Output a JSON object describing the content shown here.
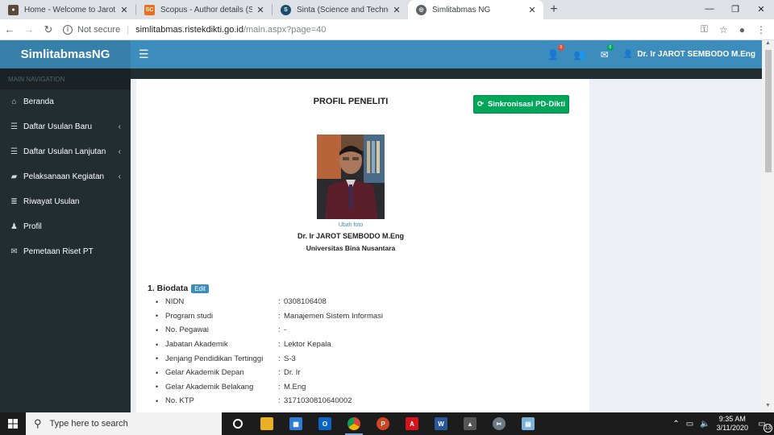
{
  "browser": {
    "tabs": [
      {
        "title": "Home - Welcome to Jarot Suroso",
        "favicon": "person-avatar-icon",
        "color": "#5a4a3a",
        "active": false
      },
      {
        "title": "Scopus - Author details (Suroso,",
        "favicon": "scopus-icon",
        "color": "#e9711c",
        "active": false
      },
      {
        "title": "Sinta (Science and Technology Ind",
        "favicon": "sinta-icon",
        "color": "#1a4d6e",
        "active": false
      },
      {
        "title": "Simlitabmas NG",
        "favicon": "globe-icon",
        "color": "#5f6368",
        "active": true
      }
    ],
    "new_tab": "+",
    "address": {
      "security": "Not secure",
      "host": "simlitabmas.ristekdikti.go.id",
      "path": "/main.aspx?page=40"
    }
  },
  "header": {
    "logo": "SimlitabmasNG",
    "badges": [
      {
        "icon": "user-plus-icon",
        "count": "0",
        "color": "#dd4b39"
      },
      {
        "icon": "users-icon",
        "count": "",
        "color": ""
      },
      {
        "icon": "envelope-icon",
        "count": "0",
        "color": "#00a65a"
      }
    ],
    "user_name": "Dr. Ir JAROT SEMBODO M.Eng"
  },
  "sidebar": {
    "header": "MAIN NAVIGATION",
    "items": [
      {
        "label": "Beranda",
        "icon": "home-icon",
        "chevron": false
      },
      {
        "label": "Daftar Usulan Baru",
        "icon": "list-icon",
        "chevron": true
      },
      {
        "label": "Daftar Usulan Lanjutan",
        "icon": "list-icon",
        "chevron": true
      },
      {
        "label": "Pelaksanaan Kegiatan",
        "icon": "book-icon",
        "chevron": true
      },
      {
        "label": "Riwayat Usulan",
        "icon": "database-icon",
        "chevron": false
      },
      {
        "label": "Profil",
        "icon": "user-icon",
        "chevron": false
      },
      {
        "label": "Pemetaan Riset PT",
        "icon": "envelope-icon",
        "chevron": false
      }
    ]
  },
  "profile": {
    "title": "PROFIL PENELITI",
    "sync_button": "Sinkronisasi PD-Dikti",
    "change_photo": "Ubah foto",
    "name": "Dr. Ir JAROT SEMBODO M.Eng",
    "university": "Universitas Bina Nusantara",
    "biodata_heading": "1. Biodata",
    "edit_label": "Edit",
    "biodata": [
      {
        "key": "NIDN",
        "value": "0308106408"
      },
      {
        "key": "Program studi",
        "value": "Manajemen Sistem Informasi"
      },
      {
        "key": "No. Pegawai",
        "value": "-"
      },
      {
        "key": "Jabatan Akademik",
        "value": "Lektor Kepala"
      },
      {
        "key": "Jenjang Pendidikan Tertinggi",
        "value": "S-3"
      },
      {
        "key": "Gelar Akademik Depan",
        "value": "Dr. Ir"
      },
      {
        "key": "Gelar Akademik Belakang",
        "value": "M.Eng"
      },
      {
        "key": "No. KTP",
        "value": "3171030810640002"
      }
    ]
  },
  "taskbar": {
    "search_placeholder": "Type here to search",
    "time": "9:35 AM",
    "date": "3/11/2020",
    "notifications": "13",
    "apps": [
      "task-view-icon",
      "file-explorer-icon",
      "store-icon",
      "outlook-icon",
      "chrome-icon",
      "powerpoint-icon",
      "acrobat-icon",
      "word-icon",
      "photos-icon",
      "snipping-icon",
      "notepad-icon"
    ]
  },
  "colors": {
    "brand": "#3c8dbc",
    "sidebar": "#222d32",
    "success": "#00a65a"
  }
}
